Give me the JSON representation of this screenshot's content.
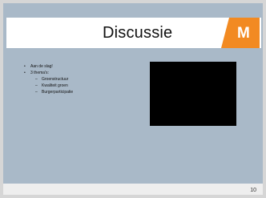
{
  "slide": {
    "title": "Discussie",
    "logo": {
      "text": "M",
      "accent_color": "#f28a22"
    },
    "bullets": [
      {
        "text": "Aan de slag!"
      },
      {
        "text": "3 thema's:",
        "sub_items": [
          "Groenstructuur",
          "Kwaliteit groen",
          "Burgerparticipatie"
        ]
      }
    ],
    "page_number": "10"
  }
}
